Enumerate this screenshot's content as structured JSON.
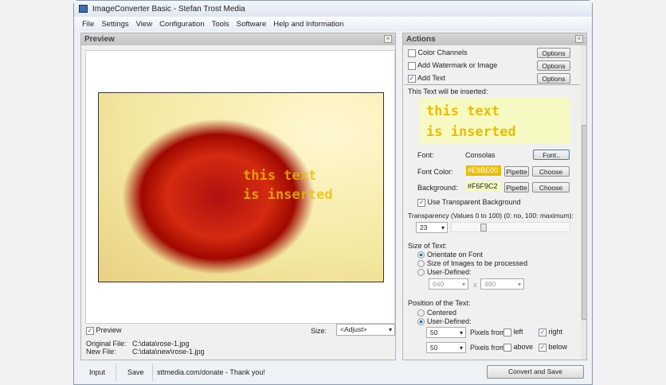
{
  "window": {
    "title": "ImageConverter Basic - Stefan Trost Media"
  },
  "menu": [
    "File",
    "Settings",
    "View",
    "Configuration",
    "Tools",
    "Software",
    "Help and Information"
  ],
  "preview": {
    "title": "Preview",
    "overlay_line1": "this text",
    "overlay_line2": "is inserted",
    "preview_label": "Preview",
    "preview_checked": true,
    "size_label": "Size:",
    "size_value": "<Adjust>",
    "original_label": "Original File:",
    "original_value": "C:\\data\\rose-1.jpg",
    "new_label": "New File:",
    "new_value": "C:\\data\\new\\rose-1.jpg"
  },
  "actions": {
    "title": "Actions",
    "items": [
      {
        "label": "Color Channels",
        "checked": false,
        "button": "Options"
      },
      {
        "label": "Add Watermark or Image",
        "checked": false,
        "button": "Options"
      },
      {
        "label": "Add Text",
        "checked": true,
        "button": "Options"
      }
    ],
    "insert_label": "This Text will be inserted:",
    "text_line1": "this text",
    "text_line2": "is inserted",
    "font_label": "Font:",
    "font_value": "Consolas",
    "font_button": "Font..",
    "font_color_label": "Font Color:",
    "font_color_value": "#E9BE00",
    "background_label": "Background:",
    "background_value": "#F6F9C2",
    "pipette": "Pipette",
    "choose": "Choose",
    "transparent_label": "Use Transparent Background",
    "transparency_label": "Transparency (Values 0 to 100) (0: no, 100: maximum):",
    "transparency_value": "23",
    "size_title": "Size of Text:",
    "size_opts": [
      "Orientate on Font",
      "Size of Images to be processed",
      "User-Defined:"
    ],
    "size_w": "640",
    "size_x": "x",
    "size_h": "480",
    "pos_title": "Position of the Text:",
    "pos_opts": [
      "Centered",
      "User-Defined:"
    ],
    "pos_h": "50",
    "pos_v": "50",
    "pixels_from": "Pixels from",
    "left": "left",
    "right": "right",
    "above": "above",
    "below": "below"
  },
  "bottom": {
    "input": "Input",
    "save": "Save",
    "donate": "sttmedia.com/donate - Thank you!",
    "convert": "Convert and Save"
  },
  "colors": {
    "font": "#E9BE00",
    "bg": "#F6F9C2"
  }
}
